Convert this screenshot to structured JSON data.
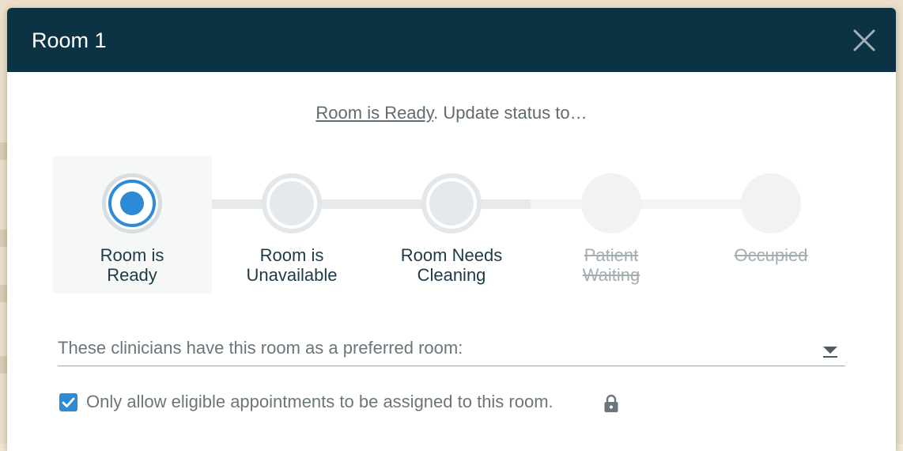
{
  "dialog": {
    "title": "Room 1",
    "close_icon": "close-icon"
  },
  "status": {
    "current": "Room is Ready",
    "suffix": ". Update status to…"
  },
  "steps": [
    {
      "line1": "Room is",
      "line2": "Ready",
      "state": "selected"
    },
    {
      "line1": "Room is",
      "line2": "Unavailable",
      "state": "available"
    },
    {
      "line1": "Room Needs",
      "line2": "Cleaning",
      "state": "available"
    },
    {
      "line1": "Patient",
      "line2": "Waiting",
      "state": "disabled"
    },
    {
      "line1": "Occupied",
      "line2": "",
      "state": "disabled"
    }
  ],
  "clinicians_select": {
    "label": "These clinicians have this room as a preferred room:",
    "icon": "chevron-down-icon"
  },
  "eligible_checkbox": {
    "checked": true,
    "label": "Only allow eligible appointments to be assigned to this room.",
    "icon": "lock-icon"
  },
  "colors": {
    "header": "#0c3344",
    "accent": "#2d8ad6",
    "text_dark": "#1d3a47",
    "text_muted": "#6b767b"
  }
}
